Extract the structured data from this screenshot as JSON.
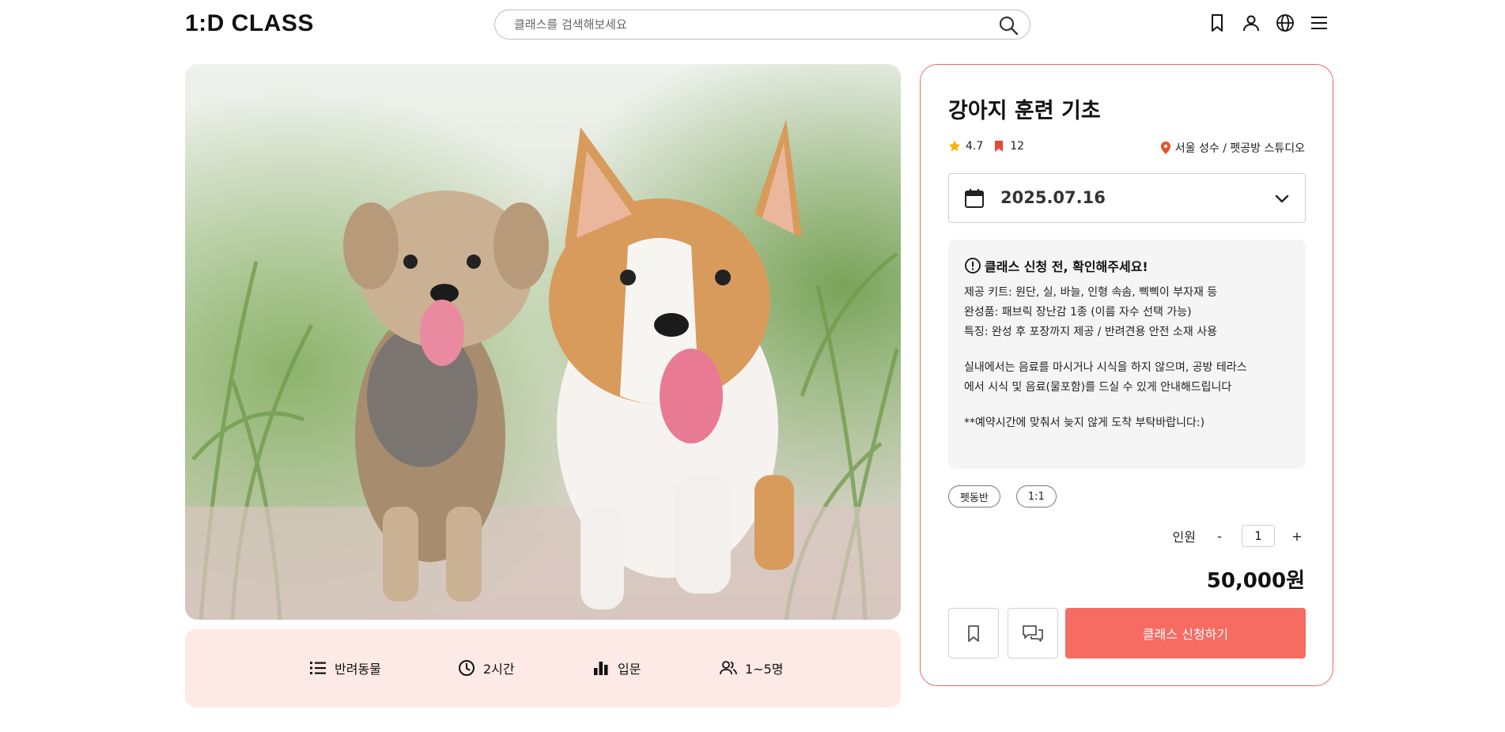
{
  "header": {
    "logo_text": "1:D CLASS",
    "search_placeholder": "클래스를 검색해보세요",
    "icons": [
      "bookmark-icon",
      "user-icon",
      "globe-icon",
      "menu-icon"
    ]
  },
  "hero": {
    "image_description_icon": "dogs-photo"
  },
  "info_bar": {
    "items": [
      {
        "icon": "list-icon",
        "label": "반려동물"
      },
      {
        "icon": "clock-icon",
        "label": "2시간"
      },
      {
        "icon": "level-bars-icon",
        "label": "입문"
      },
      {
        "icon": "people-icon",
        "label": "1~5명"
      }
    ]
  },
  "card": {
    "title": "강아지 훈련 기초",
    "rating": "4.7",
    "bookmarks": "12",
    "location": "서울 성수 / 펫공방 스튜디오",
    "date": "2025.07.16",
    "notice": {
      "heading": "클래스 신청 전, 확인해주세요!",
      "lines": [
        "제공 키트: 원단, 실, 바늘, 인형 속솜, 삑삑이 부자재 등",
        "완성품: 패브릭 장난감 1종 (이름 자수 선택 가능)",
        "특징: 완성 후 포장까지 제공 / 반려견용 안전 소재 사용",
        "실내에서는 음료를 마시거나 시식을 하지 않으며, 공방 테라스",
        "에서 시식 및 음료(물포함)를 드실 수 있게 안내해드립니다",
        "**예약시간에 맞춰서 늦지 않게 도착 부탁바랍니다:)"
      ]
    },
    "tags": [
      "펫동반",
      "1:1"
    ],
    "people_label": "인원",
    "minus": "-",
    "plus": "+",
    "quantity": "1",
    "price": "50,000원",
    "apply_label": "클래스 신청하기"
  },
  "colors": {
    "accent": "#f66b62",
    "card_border": "#f0665f",
    "info_bar_bg": "#fde9e6",
    "star": "#f5b400",
    "pin": "#e8522b"
  }
}
